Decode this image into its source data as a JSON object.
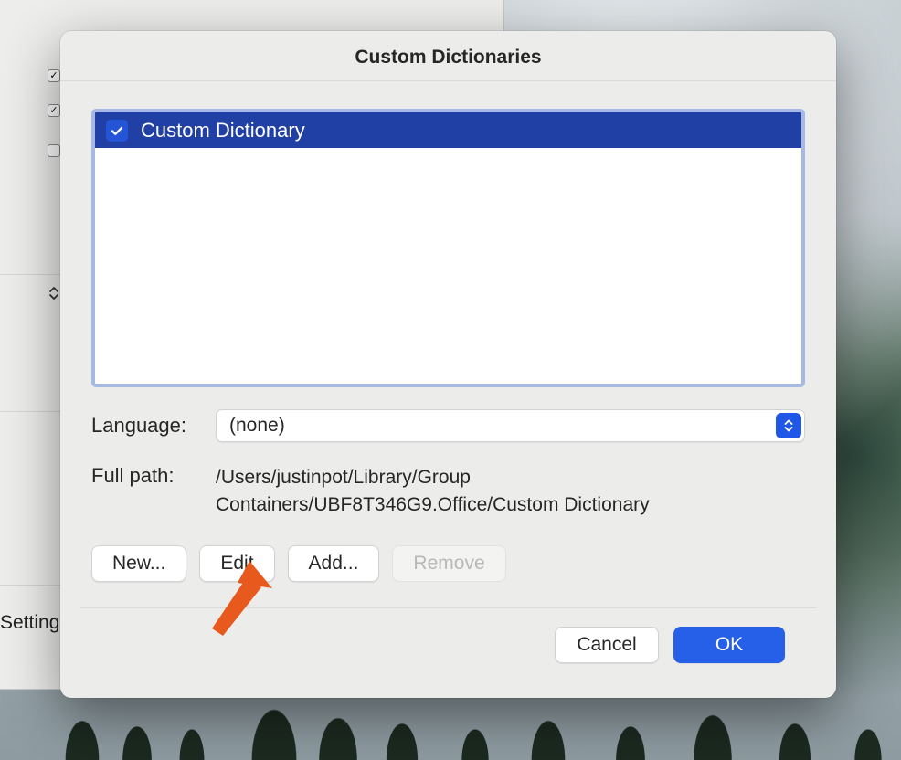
{
  "dialog": {
    "title": "Custom Dictionaries",
    "list": {
      "items": [
        {
          "checked": true,
          "label": "Custom Dictionary"
        }
      ]
    },
    "language": {
      "label": "Language:",
      "selected": "(none)"
    },
    "path": {
      "label": "Full path:",
      "value": "/Users/justinpot/Library/Group Containers/UBF8T346G9.Office/Custom Dictionary"
    },
    "buttons": {
      "new": "New...",
      "edit": "Edit",
      "add": "Add...",
      "remove": "Remove",
      "cancel": "Cancel",
      "ok": "OK"
    }
  },
  "parent": {
    "truncated_label": "Setting"
  }
}
